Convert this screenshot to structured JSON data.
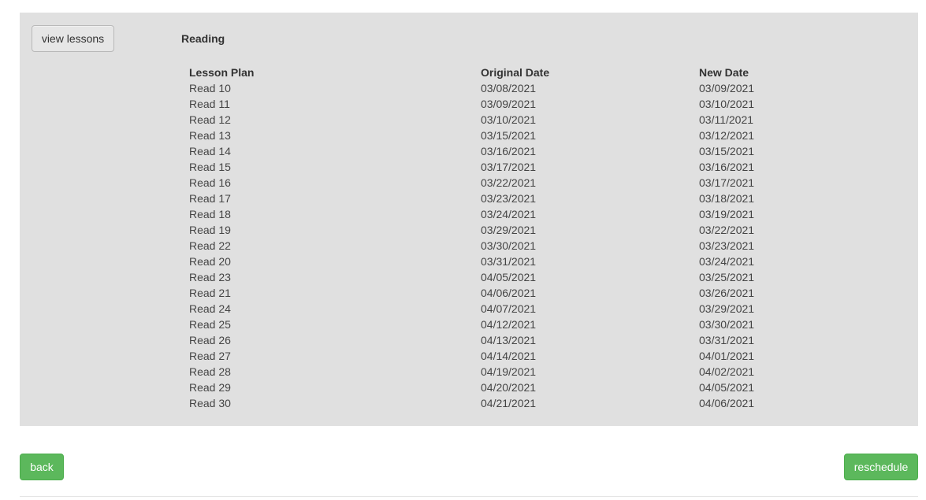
{
  "panel": {
    "view_lessons_label": "view lessons",
    "subject": "Reading"
  },
  "table": {
    "headers": [
      "Lesson Plan",
      "Original Date",
      "New Date"
    ],
    "rows": [
      [
        "Read 10",
        "03/08/2021",
        "03/09/2021"
      ],
      [
        "Read 11",
        "03/09/2021",
        "03/10/2021"
      ],
      [
        "Read 12",
        "03/10/2021",
        "03/11/2021"
      ],
      [
        "Read 13",
        "03/15/2021",
        "03/12/2021"
      ],
      [
        "Read 14",
        "03/16/2021",
        "03/15/2021"
      ],
      [
        "Read 15",
        "03/17/2021",
        "03/16/2021"
      ],
      [
        "Read 16",
        "03/22/2021",
        "03/17/2021"
      ],
      [
        "Read 17",
        "03/23/2021",
        "03/18/2021"
      ],
      [
        "Read 18",
        "03/24/2021",
        "03/19/2021"
      ],
      [
        "Read 19",
        "03/29/2021",
        "03/22/2021"
      ],
      [
        "Read 22",
        "03/30/2021",
        "03/23/2021"
      ],
      [
        "Read 20",
        "03/31/2021",
        "03/24/2021"
      ],
      [
        "Read 23",
        "04/05/2021",
        "03/25/2021"
      ],
      [
        "Read 21",
        "04/06/2021",
        "03/26/2021"
      ],
      [
        "Read 24",
        "04/07/2021",
        "03/29/2021"
      ],
      [
        "Read 25",
        "04/12/2021",
        "03/30/2021"
      ],
      [
        "Read 26",
        "04/13/2021",
        "03/31/2021"
      ],
      [
        "Read 27",
        "04/14/2021",
        "04/01/2021"
      ],
      [
        "Read 28",
        "04/19/2021",
        "04/02/2021"
      ],
      [
        "Read 29",
        "04/20/2021",
        "04/05/2021"
      ],
      [
        "Read 30",
        "04/21/2021",
        "04/06/2021"
      ]
    ]
  },
  "footer": {
    "back_label": "back",
    "reschedule_label": "reschedule"
  },
  "colors": {
    "panel_bg": "#e0e0e0",
    "primary_green": "#5cb85c"
  }
}
